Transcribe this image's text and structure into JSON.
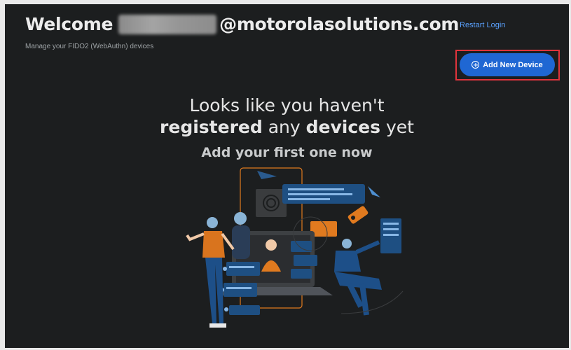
{
  "header": {
    "welcome": "Welcome",
    "domain": "@motorolasolutions.com",
    "restart_login": "Restart Login",
    "subtitle": "Manage your FIDO2 (WebAuthn) devices"
  },
  "actions": {
    "add_device_label": "Add New Device",
    "add_device_icon": "plus-circle-icon"
  },
  "empty_state": {
    "line1": "Looks like you haven't",
    "registered": "registered",
    "any": "any",
    "devices": "devices",
    "yet": "yet",
    "cta": "Add your first one now"
  },
  "colors": {
    "background": "#1c1e1f",
    "primary_button": "#1f67d3",
    "link": "#5aa2ff",
    "highlight": "#e0343c",
    "accent_orange": "#e07a1f"
  }
}
